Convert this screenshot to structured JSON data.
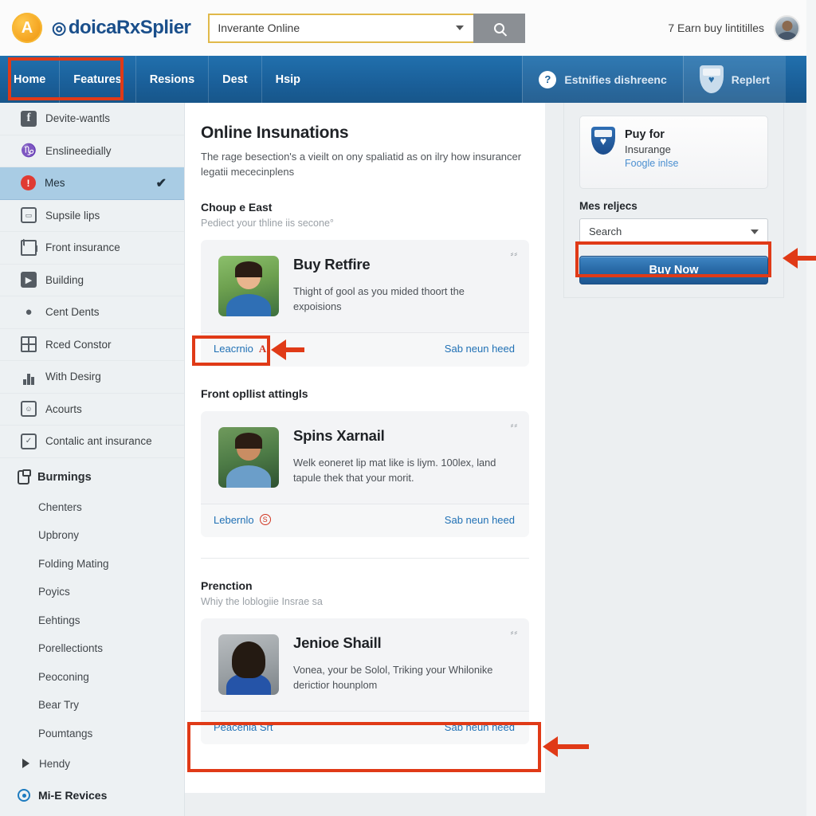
{
  "header": {
    "logo_letter": "A",
    "logo_glyph": "◎",
    "brand": "doicaRxSplier",
    "search_value": "Inverante Online",
    "search_placeholder": "Inverante Online",
    "search_icon": "search-icon",
    "user_label": "7 Earn buy lintitilles"
  },
  "nav": {
    "items": [
      {
        "label": "Home"
      },
      {
        "label": "Features"
      },
      {
        "label": "Resions"
      },
      {
        "label": "Dest"
      },
      {
        "label": "Hsip"
      }
    ],
    "right_buttons": [
      {
        "label": "Estnifies dishreenc",
        "icon": "question-mark-icon",
        "glyph": "?"
      },
      {
        "label": "Replert",
        "icon": "heart-icon",
        "glyph": "♥"
      }
    ]
  },
  "sidebar": {
    "items": [
      {
        "label": "Devite-wantls",
        "icon": "facebook-icon",
        "glyph": "f",
        "active": false
      },
      {
        "label": "Enslineedially",
        "icon": "tree-icon",
        "glyph": "♑",
        "active": false
      },
      {
        "label": "Mes",
        "icon": "alert-icon",
        "glyph": "!",
        "active": true,
        "check": "✔"
      },
      {
        "label": "Supsile lips",
        "icon": "inbox-icon",
        "glyph": "▭",
        "active": false
      },
      {
        "label": "Front insurance",
        "icon": "envelope-icon",
        "glyph": "",
        "active": false
      },
      {
        "label": "Building",
        "icon": "forward-icon",
        "glyph": "▶",
        "active": false
      },
      {
        "label": "Cent Dents",
        "icon": "drop-icon",
        "glyph": "●",
        "active": false
      },
      {
        "label": "Rced Constor",
        "icon": "grid-icon",
        "glyph": "",
        "active": false
      },
      {
        "label": "With Desirg",
        "icon": "chart-icon",
        "glyph": "",
        "active": false
      },
      {
        "label": "Acourts",
        "icon": "account-icon",
        "glyph": "☺",
        "active": false
      },
      {
        "label": "Contalic ant insurance",
        "icon": "contract-icon",
        "glyph": "✓",
        "active": false
      }
    ],
    "group": {
      "label": "Burmings",
      "icon": "clipboard-icon"
    },
    "sub_items": [
      {
        "label": "Chenters"
      },
      {
        "label": "Upbrony"
      },
      {
        "label": "Folding Mating"
      },
      {
        "label": "Poyics"
      },
      {
        "label": "Eehtings"
      },
      {
        "label": "Porellectionts"
      },
      {
        "label": "Peoconing"
      },
      {
        "label": "Bear Try"
      },
      {
        "label": "Poumtangs"
      }
    ],
    "expandable": {
      "label": "Hendy",
      "icon": "triangle-right-icon"
    },
    "bottom": {
      "label": "Mi-E Revices",
      "icon": "target-icon"
    }
  },
  "main": {
    "title": "Online Insunations",
    "subtitle": "The rage besection's a vieilt on ony spaliatid as on ilry how insurancer legatii mececinplens",
    "section1": {
      "heading": "Choup e East",
      "sub": "Pediect your thline iis secone°"
    },
    "section2": {
      "heading": "Front opllist attingls"
    },
    "section3": {
      "heading": "Prenction",
      "sub": "Whiy the loblogiie Insrae sa"
    },
    "cards": [
      {
        "title": "Buy Retfire",
        "desc": "Thight of gool as you mided thoort the expoisions",
        "corner": "⸗⸗",
        "link_left": "Leacrnio",
        "link_left_badge": "A",
        "link_right": "Sab neun heed",
        "thumb": "person-photo-1"
      },
      {
        "title": "Spins Xarnail",
        "desc": "Welk eoneret lip mat like is liym. 100lex, land tapule thek that your morit.",
        "corner": "⸗⸗",
        "link_left": "Lebernlo",
        "link_left_badge": "S",
        "link_right": "Sab neun heed",
        "thumb": "person-photo-2"
      },
      {
        "title": "Jenioe Shaill",
        "desc": "Vonea, your be Solol, Triking your Whilonike derictior hounplom",
        "corner": "⸗⸗",
        "link_left": "Peacenia Sŕt",
        "link_left_badge": "",
        "link_right": "Sab neun heed",
        "thumb": "person-photo-3"
      }
    ]
  },
  "right_panel": {
    "promo": {
      "title": "Puy for",
      "subtitle": "Insurange",
      "link": "Foogle inlse",
      "icon": "shield-icon",
      "glyph": "♥"
    },
    "field_label": "Mes reljecs",
    "select_value": "Search",
    "buy_button": "Buy Now"
  },
  "colors": {
    "nav_blue": "#1a5f99",
    "accent_red": "#e03a17",
    "link_blue": "#2171b5",
    "brand_blue": "#1a4f8b",
    "sidebar_active": "#a9cce4",
    "logo_orange": "#f5a623"
  }
}
